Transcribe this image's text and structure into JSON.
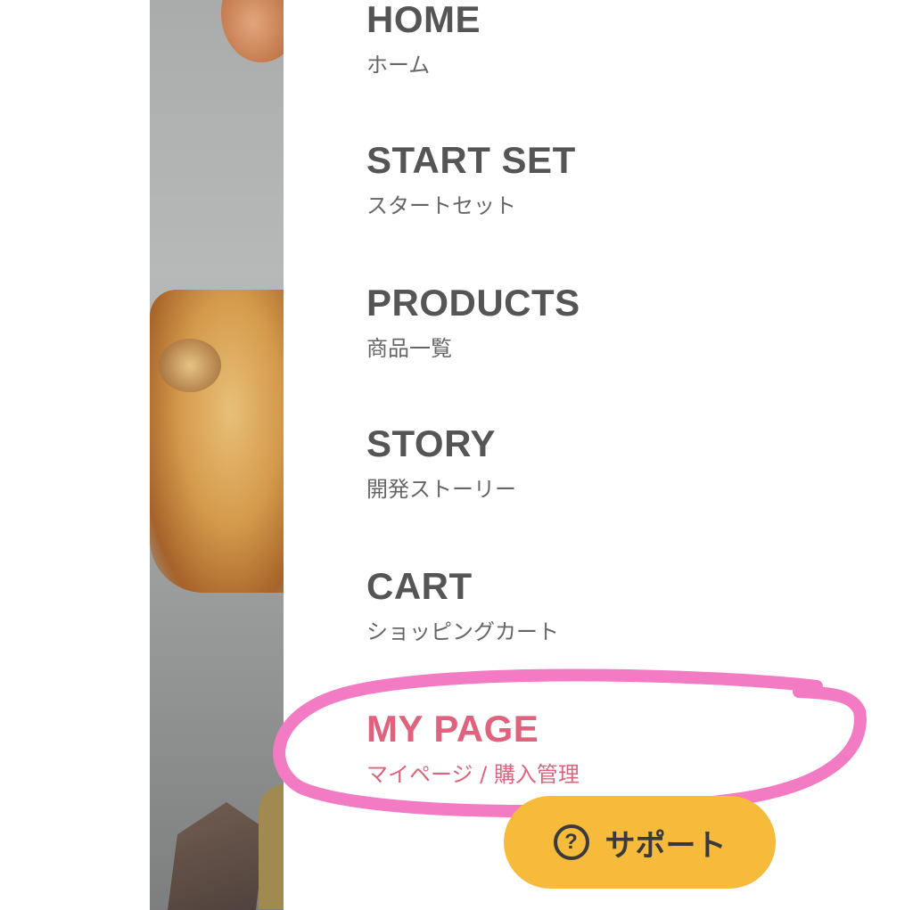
{
  "menu": {
    "items": [
      {
        "en": "HOME",
        "jp": "ホーム"
      },
      {
        "en": "START SET",
        "jp": "スタートセット"
      },
      {
        "en": "PRODUCTS",
        "jp": "商品一覧"
      },
      {
        "en": "STORY",
        "jp": "開発ストーリー"
      },
      {
        "en": "CART",
        "jp": "ショッピングカート"
      },
      {
        "en": "MY PAGE",
        "jp": "マイページ / 購入管理"
      }
    ]
  },
  "support": {
    "label": "サポート",
    "icon": "question-circle-icon"
  },
  "colors": {
    "active": "#e0627c",
    "annotation": "#f27bc4",
    "support_bg": "#f7bb3c",
    "text": "#555555"
  }
}
